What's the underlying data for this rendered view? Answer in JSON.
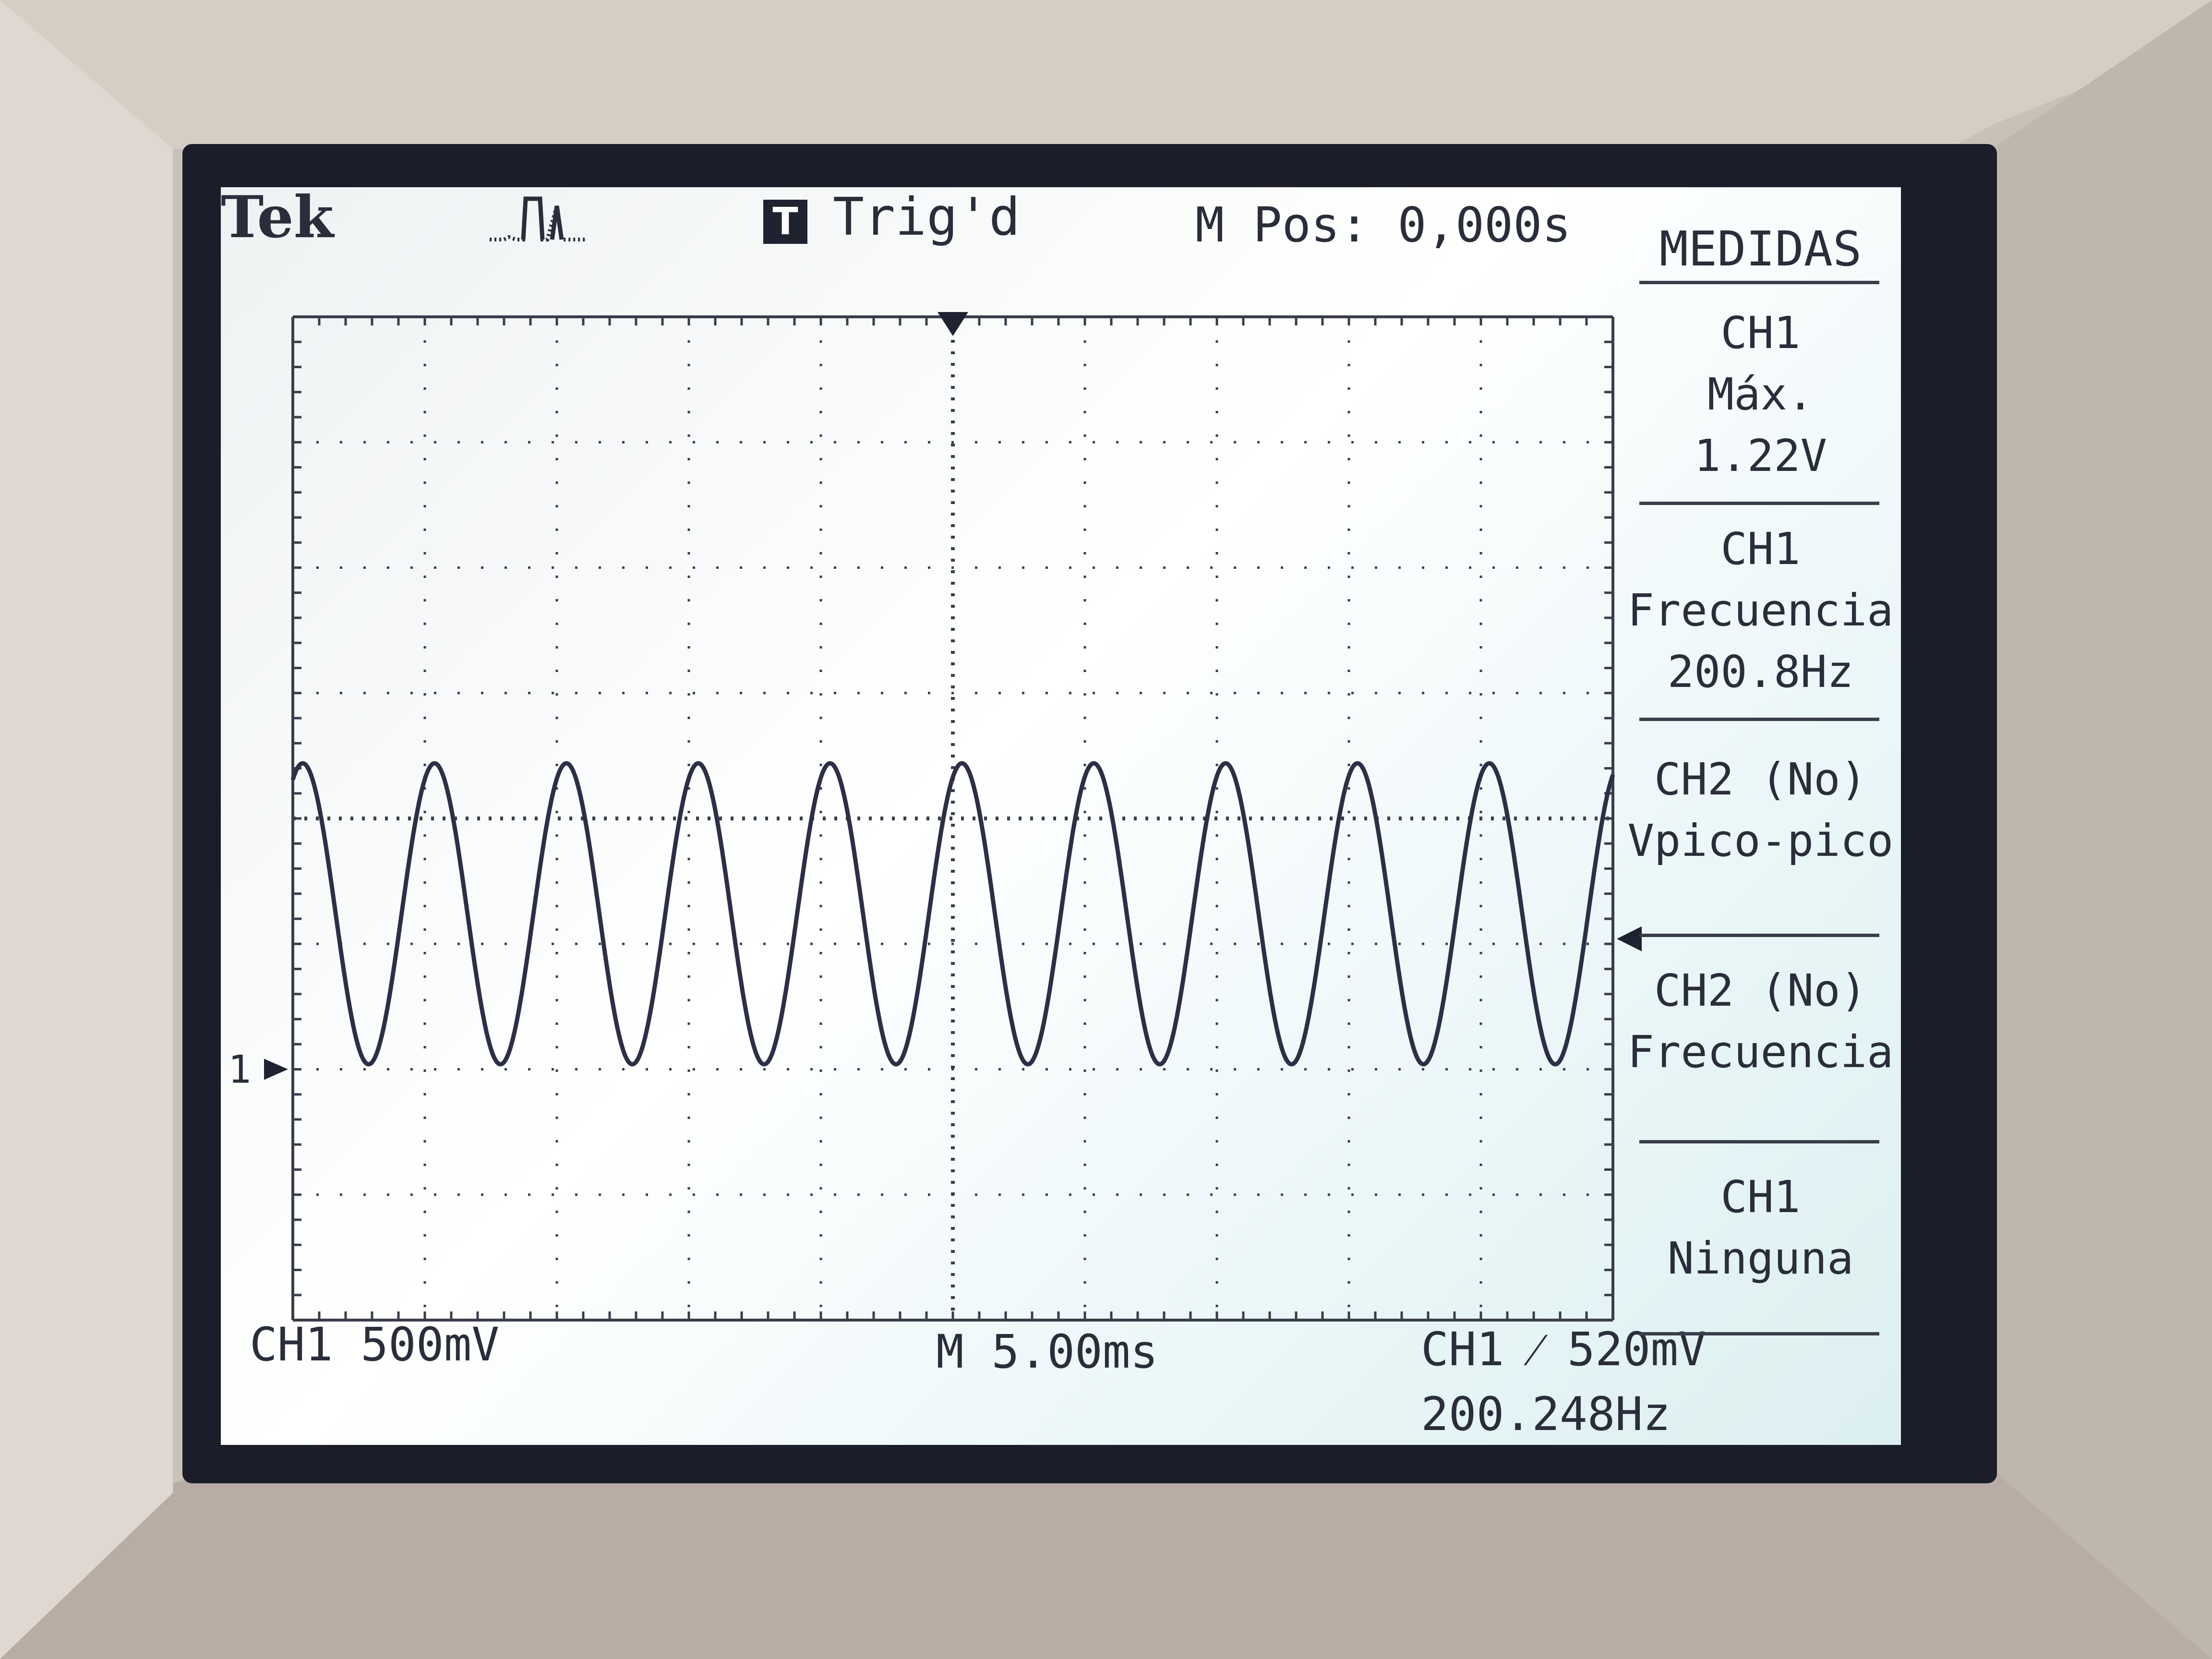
{
  "header": {
    "brand": "Tek",
    "trigger_badge": "T",
    "trigger_status": "Trig'd",
    "main_position": "M Pos: 0,000s",
    "acquire_icon": "pulse-waveform-icon"
  },
  "side_menu": {
    "title": "MEDIDAS",
    "items": [
      {
        "source": "CH1",
        "type": "Máx.",
        "value": "1.22V"
      },
      {
        "source": "CH1",
        "type": "Frecuencia",
        "value": "200.8Hz"
      },
      {
        "source": "CH2 (No)",
        "type": "Vpico-pico",
        "value": ""
      },
      {
        "source": "CH2 (No)",
        "type": "Frecuencia",
        "value": ""
      },
      {
        "source": "CH1",
        "type": "Ninguna",
        "value": ""
      }
    ]
  },
  "footer": {
    "ch1_scale": "CH1  500mV",
    "timebase": "M 5.00ms",
    "trigger": "CH1  ⁄  520mV",
    "trigger_frequency": "200.248Hz"
  },
  "markers": {
    "ch1_ground": "1"
  },
  "colors": {
    "trace": "#2c2f45",
    "screen_bg": "#f4f8f8",
    "bezel": "#d8d0c8",
    "graticule": "#3a3d4a"
  },
  "chart_data": {
    "type": "line",
    "title": "",
    "xlabel": "",
    "ylabel": "",
    "series": [
      {
        "signal": "sine",
        "frequency_hz": 200.248,
        "max_v": 1.22,
        "min_v": 0.02,
        "periods_visible": 10
      }
    ],
    "volts_per_div": 0.5,
    "seconds_per_div": 0.005,
    "xlim_divs": [
      0,
      10
    ],
    "ylim_divs": [
      -4,
      4
    ],
    "ground_level_div": -2,
    "grid": true
  }
}
